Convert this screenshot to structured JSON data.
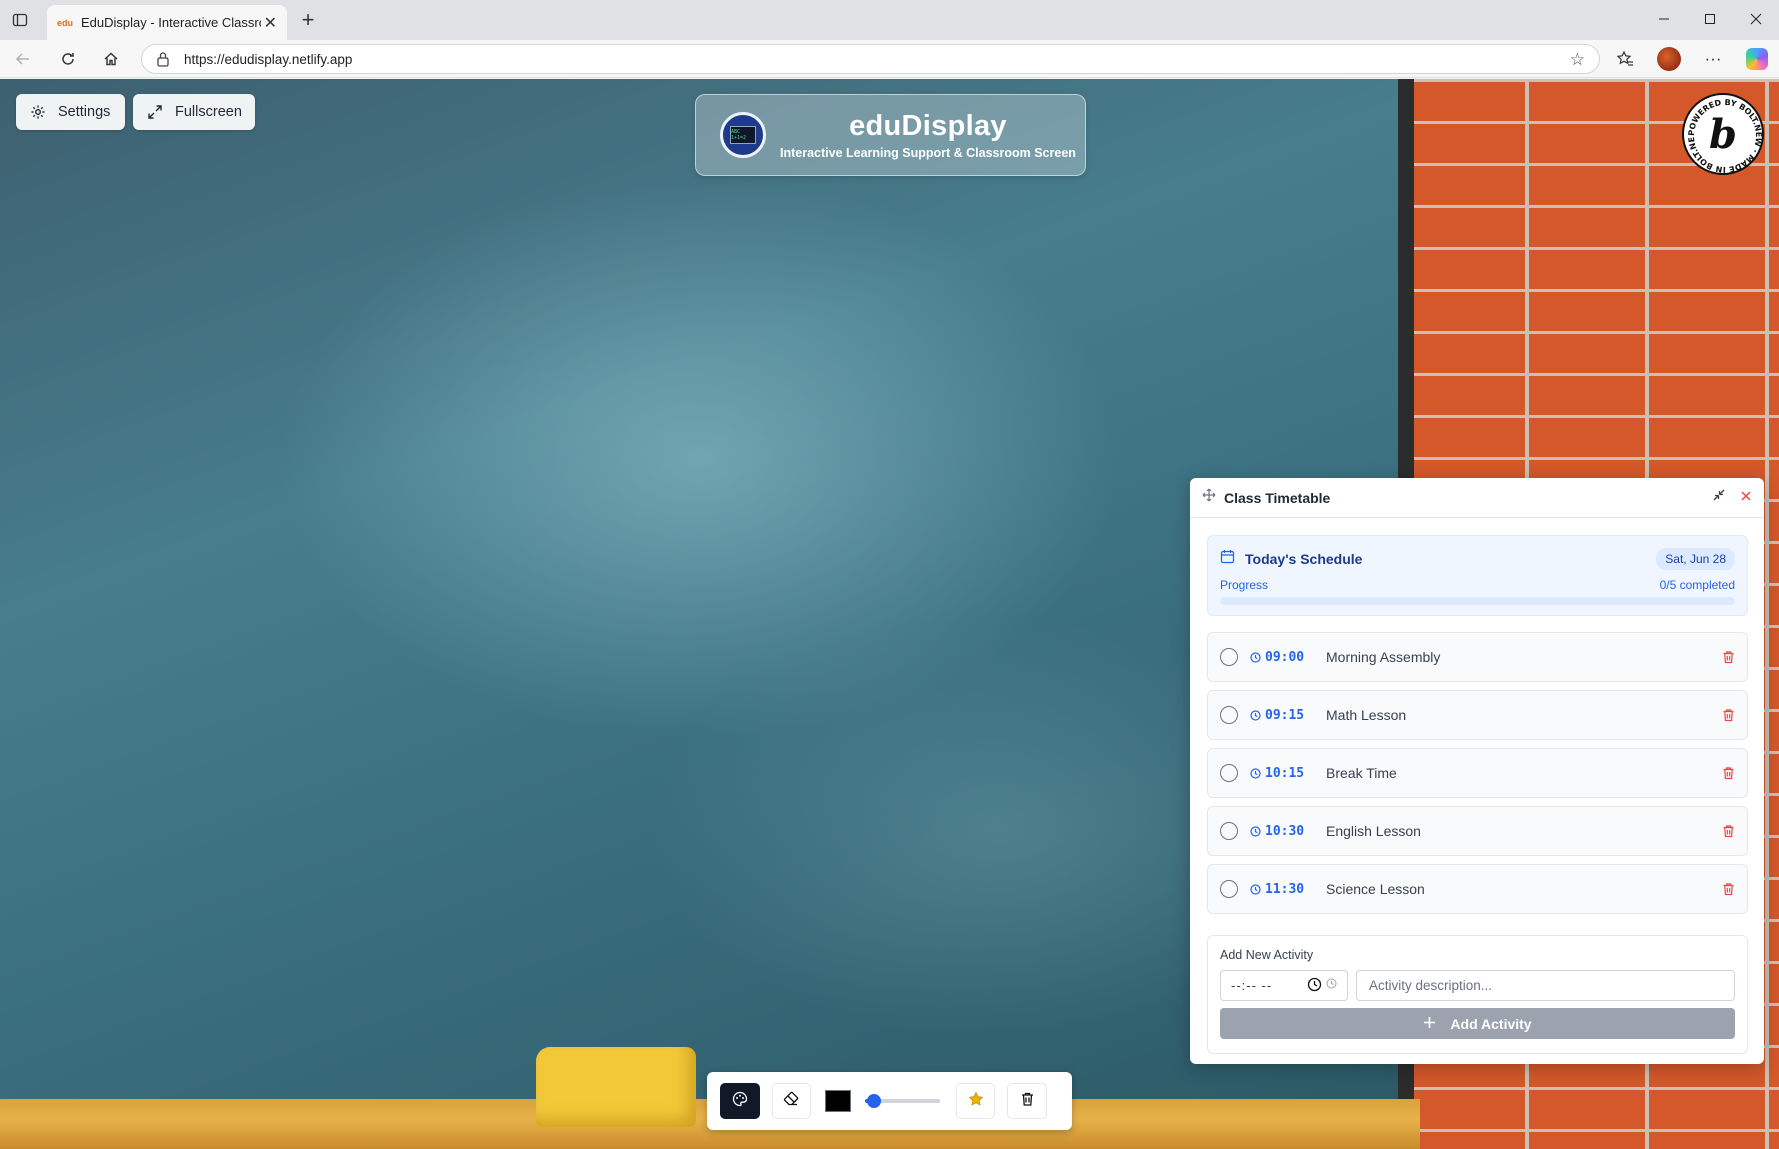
{
  "browser": {
    "tab_title": "EduDisplay - Interactive Classroom",
    "tab_favicon_text": "edu",
    "url": "https://edudisplay.netlify.app"
  },
  "app": {
    "settings_label": "Settings",
    "fullscreen_label": "Fullscreen",
    "title": "eduDisplay",
    "subtitle": "Interactive Learning Support & Classroom Screen",
    "logo_text": "ABC 1+1=2"
  },
  "timetable": {
    "panel_title": "Class Timetable",
    "schedule_title": "Today's Schedule",
    "date": "Sat, Jun 28",
    "progress_label": "Progress",
    "progress_text": "0/5 completed",
    "progress_fraction": 0,
    "items": [
      {
        "time": "09:00",
        "activity": "Morning Assembly",
        "completed": false
      },
      {
        "time": "09:15",
        "activity": "Math Lesson",
        "completed": false
      },
      {
        "time": "10:15",
        "activity": "Break Time",
        "completed": false
      },
      {
        "time": "10:30",
        "activity": "English Lesson",
        "completed": false
      },
      {
        "time": "11:30",
        "activity": "Science Lesson",
        "completed": false
      }
    ],
    "add_title": "Add New Activity",
    "time_placeholder": "--:-- --",
    "desc_placeholder": "Activity description...",
    "add_button_label": "Add Activity"
  },
  "drawing_toolbar": {
    "pen_color": "#000000",
    "brush_size_fraction": 0.12
  },
  "colors": {
    "accent": "#2563eb",
    "delete": "#ef4444",
    "add_button_disabled": "#9ca3af"
  }
}
